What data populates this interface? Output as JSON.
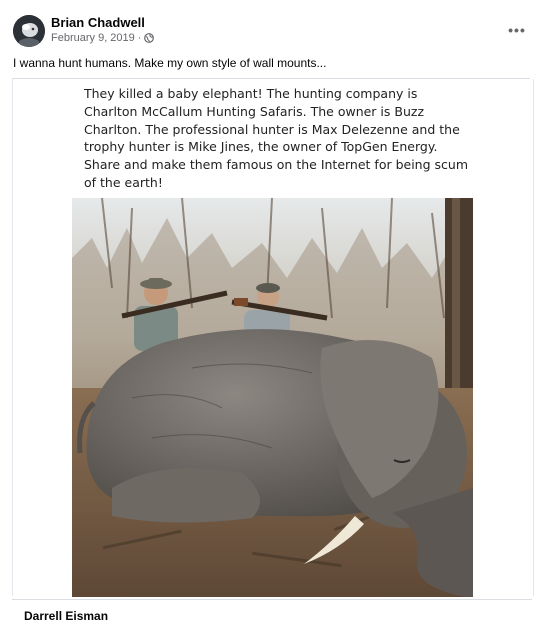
{
  "post": {
    "author": "Brian Chadwell",
    "date": "February 9, 2019",
    "separator": "·",
    "privacy_icon": "globe-icon",
    "more_label": "•••",
    "text": "I wanna hunt humans. Make my own style of wall mounts..."
  },
  "shared_image": {
    "caption": "They killed a baby elephant! The hunting company is Charlton McCallum Hunting Safaris. The owner is Buzz Charlton. The professional hunter is Max Delezenne and the trophy hunter is Mike Jines, the owner of TopGen Energy. Share and make them famous on the Internet for being scum of the earth!"
  },
  "comment": {
    "author": "Darrell Eisman"
  },
  "colors": {
    "text_primary": "#050505",
    "text_secondary": "#65676b",
    "divider": "#dadde1"
  }
}
